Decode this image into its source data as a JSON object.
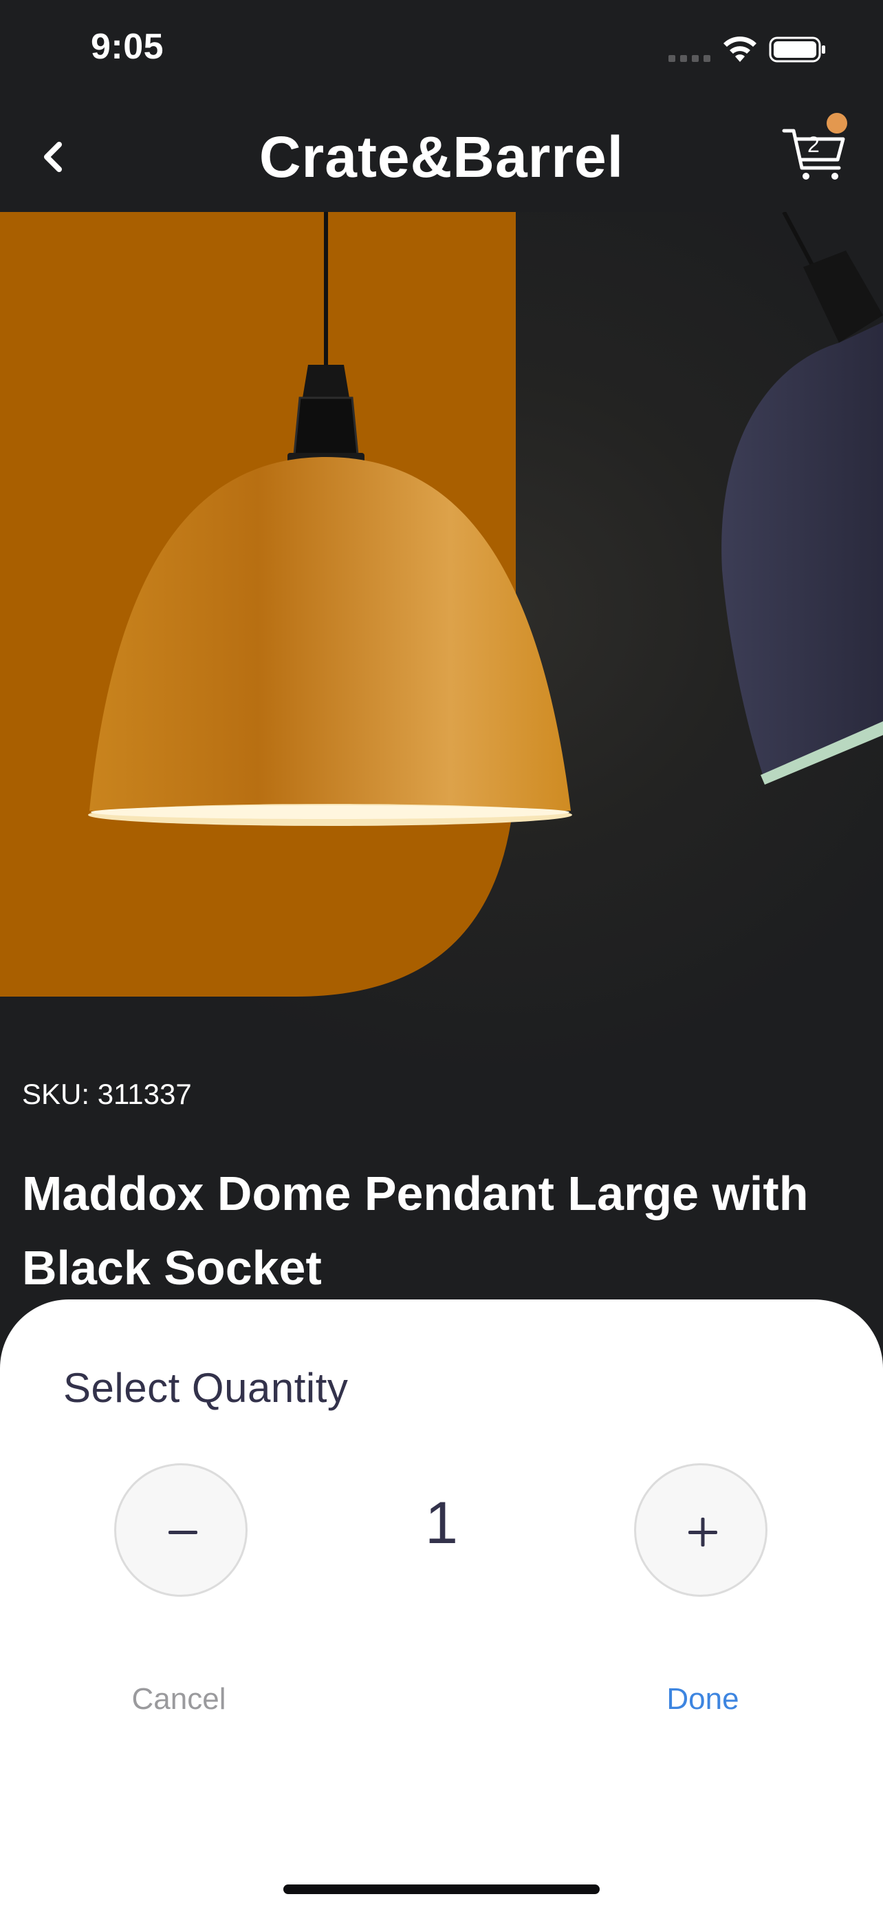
{
  "status_bar": {
    "time": "9:05",
    "icons": [
      "cellular-signal-icon",
      "wifi-icon",
      "battery-icon"
    ]
  },
  "nav": {
    "title": "Crate&Barrel",
    "back_icon": "chevron-left-icon",
    "cart_icon": "cart-icon",
    "cart_count": "2",
    "cart_badge_color": "#e3984f"
  },
  "hero": {
    "image": "pendant-lamp-product-photo",
    "background_accent": "#a95f00",
    "lamp_color": "#d9921e",
    "alt_lamp_color": "#33334a"
  },
  "product": {
    "sku_label": "SKU: 311337",
    "title": "Maddox Dome Pendant Large with Black Socket"
  },
  "quantity_sheet": {
    "title": "Select Quantity",
    "decrement_label": "−",
    "increment_label": "+",
    "quantity": "1",
    "cancel_label": "Cancel",
    "done_label": "Done",
    "done_color": "#3d85e0"
  }
}
